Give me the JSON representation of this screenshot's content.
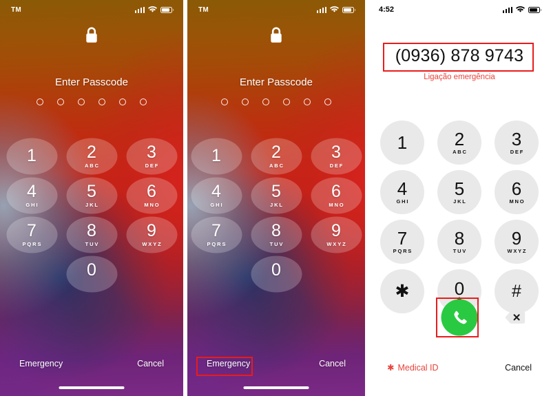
{
  "panels": {
    "lock_screen_1": {
      "name": "lock-screen-passcode",
      "status": {
        "carrier": "TM",
        "signal_icon": "cellular-signal-icon",
        "wifi_icon": "wifi-icon",
        "battery_icon": "battery-icon"
      },
      "lock_icon": "padlock-closed-icon",
      "title": "Enter Passcode",
      "passcode_dots": 6,
      "keypad": [
        {
          "num": "1",
          "letters": ""
        },
        {
          "num": "2",
          "letters": "ABC"
        },
        {
          "num": "3",
          "letters": "DEF"
        },
        {
          "num": "4",
          "letters": "GHI"
        },
        {
          "num": "5",
          "letters": "JKL"
        },
        {
          "num": "6",
          "letters": "MNO"
        },
        {
          "num": "7",
          "letters": "PQRS"
        },
        {
          "num": "8",
          "letters": "TUV"
        },
        {
          "num": "9",
          "letters": "WXYZ"
        },
        {
          "num": "0",
          "letters": ""
        }
      ],
      "emergency_label": "Emergency",
      "cancel_label": "Cancel"
    },
    "lock_screen_2": {
      "name": "lock-screen-passcode-emergency-highlighted",
      "status": {
        "carrier": "TM",
        "signal_icon": "cellular-signal-icon",
        "wifi_icon": "wifi-icon",
        "battery_icon": "battery-icon"
      },
      "lock_icon": "padlock-closed-icon",
      "title": "Enter Passcode",
      "passcode_dots": 6,
      "keypad": [
        {
          "num": "1",
          "letters": ""
        },
        {
          "num": "2",
          "letters": "ABC"
        },
        {
          "num": "3",
          "letters": "DEF"
        },
        {
          "num": "4",
          "letters": "GHI"
        },
        {
          "num": "5",
          "letters": "JKL"
        },
        {
          "num": "6",
          "letters": "MNO"
        },
        {
          "num": "7",
          "letters": "PQRS"
        },
        {
          "num": "8",
          "letters": "TUV"
        },
        {
          "num": "9",
          "letters": "WXYZ"
        },
        {
          "num": "0",
          "letters": ""
        }
      ],
      "emergency_label": "Emergency",
      "cancel_label": "Cancel"
    },
    "dialer": {
      "name": "emergency-dialer",
      "status": {
        "clock": "4:52",
        "signal_icon": "cellular-signal-icon",
        "wifi_icon": "wifi-icon",
        "battery_icon": "battery-icon"
      },
      "phone_number": "(0936) 878 9743",
      "number_caption": "Ligação emergência",
      "keypad": [
        {
          "num": "1",
          "letters": ""
        },
        {
          "num": "2",
          "letters": "ABC"
        },
        {
          "num": "3",
          "letters": "DEF"
        },
        {
          "num": "4",
          "letters": "GHI"
        },
        {
          "num": "5",
          "letters": "JKL"
        },
        {
          "num": "6",
          "letters": "MNO"
        },
        {
          "num": "7",
          "letters": "PQRS"
        },
        {
          "num": "8",
          "letters": "TUV"
        },
        {
          "num": "9",
          "letters": "WXYZ"
        },
        {
          "num": "✱",
          "letters": ""
        },
        {
          "num": "0",
          "letters": "+"
        },
        {
          "num": "#",
          "letters": ""
        }
      ],
      "call_button_icon": "phone-handset-icon",
      "delete_button_icon": "backspace-delete-icon",
      "medical_id_label": "Medical ID",
      "medical_id_icon": "asterisk-icon",
      "cancel_label": "Cancel"
    }
  },
  "annotations": {
    "phone_number_box": "red-highlight-phone-number",
    "emergency_box": "red-highlight-emergency-button",
    "call_box": "red-highlight-call-button"
  },
  "colors": {
    "annotation_red": "#e81c1c",
    "emergency_text_red": "#e8433b",
    "call_green": "#29ca42",
    "key_gray": "#e9e9e9"
  }
}
